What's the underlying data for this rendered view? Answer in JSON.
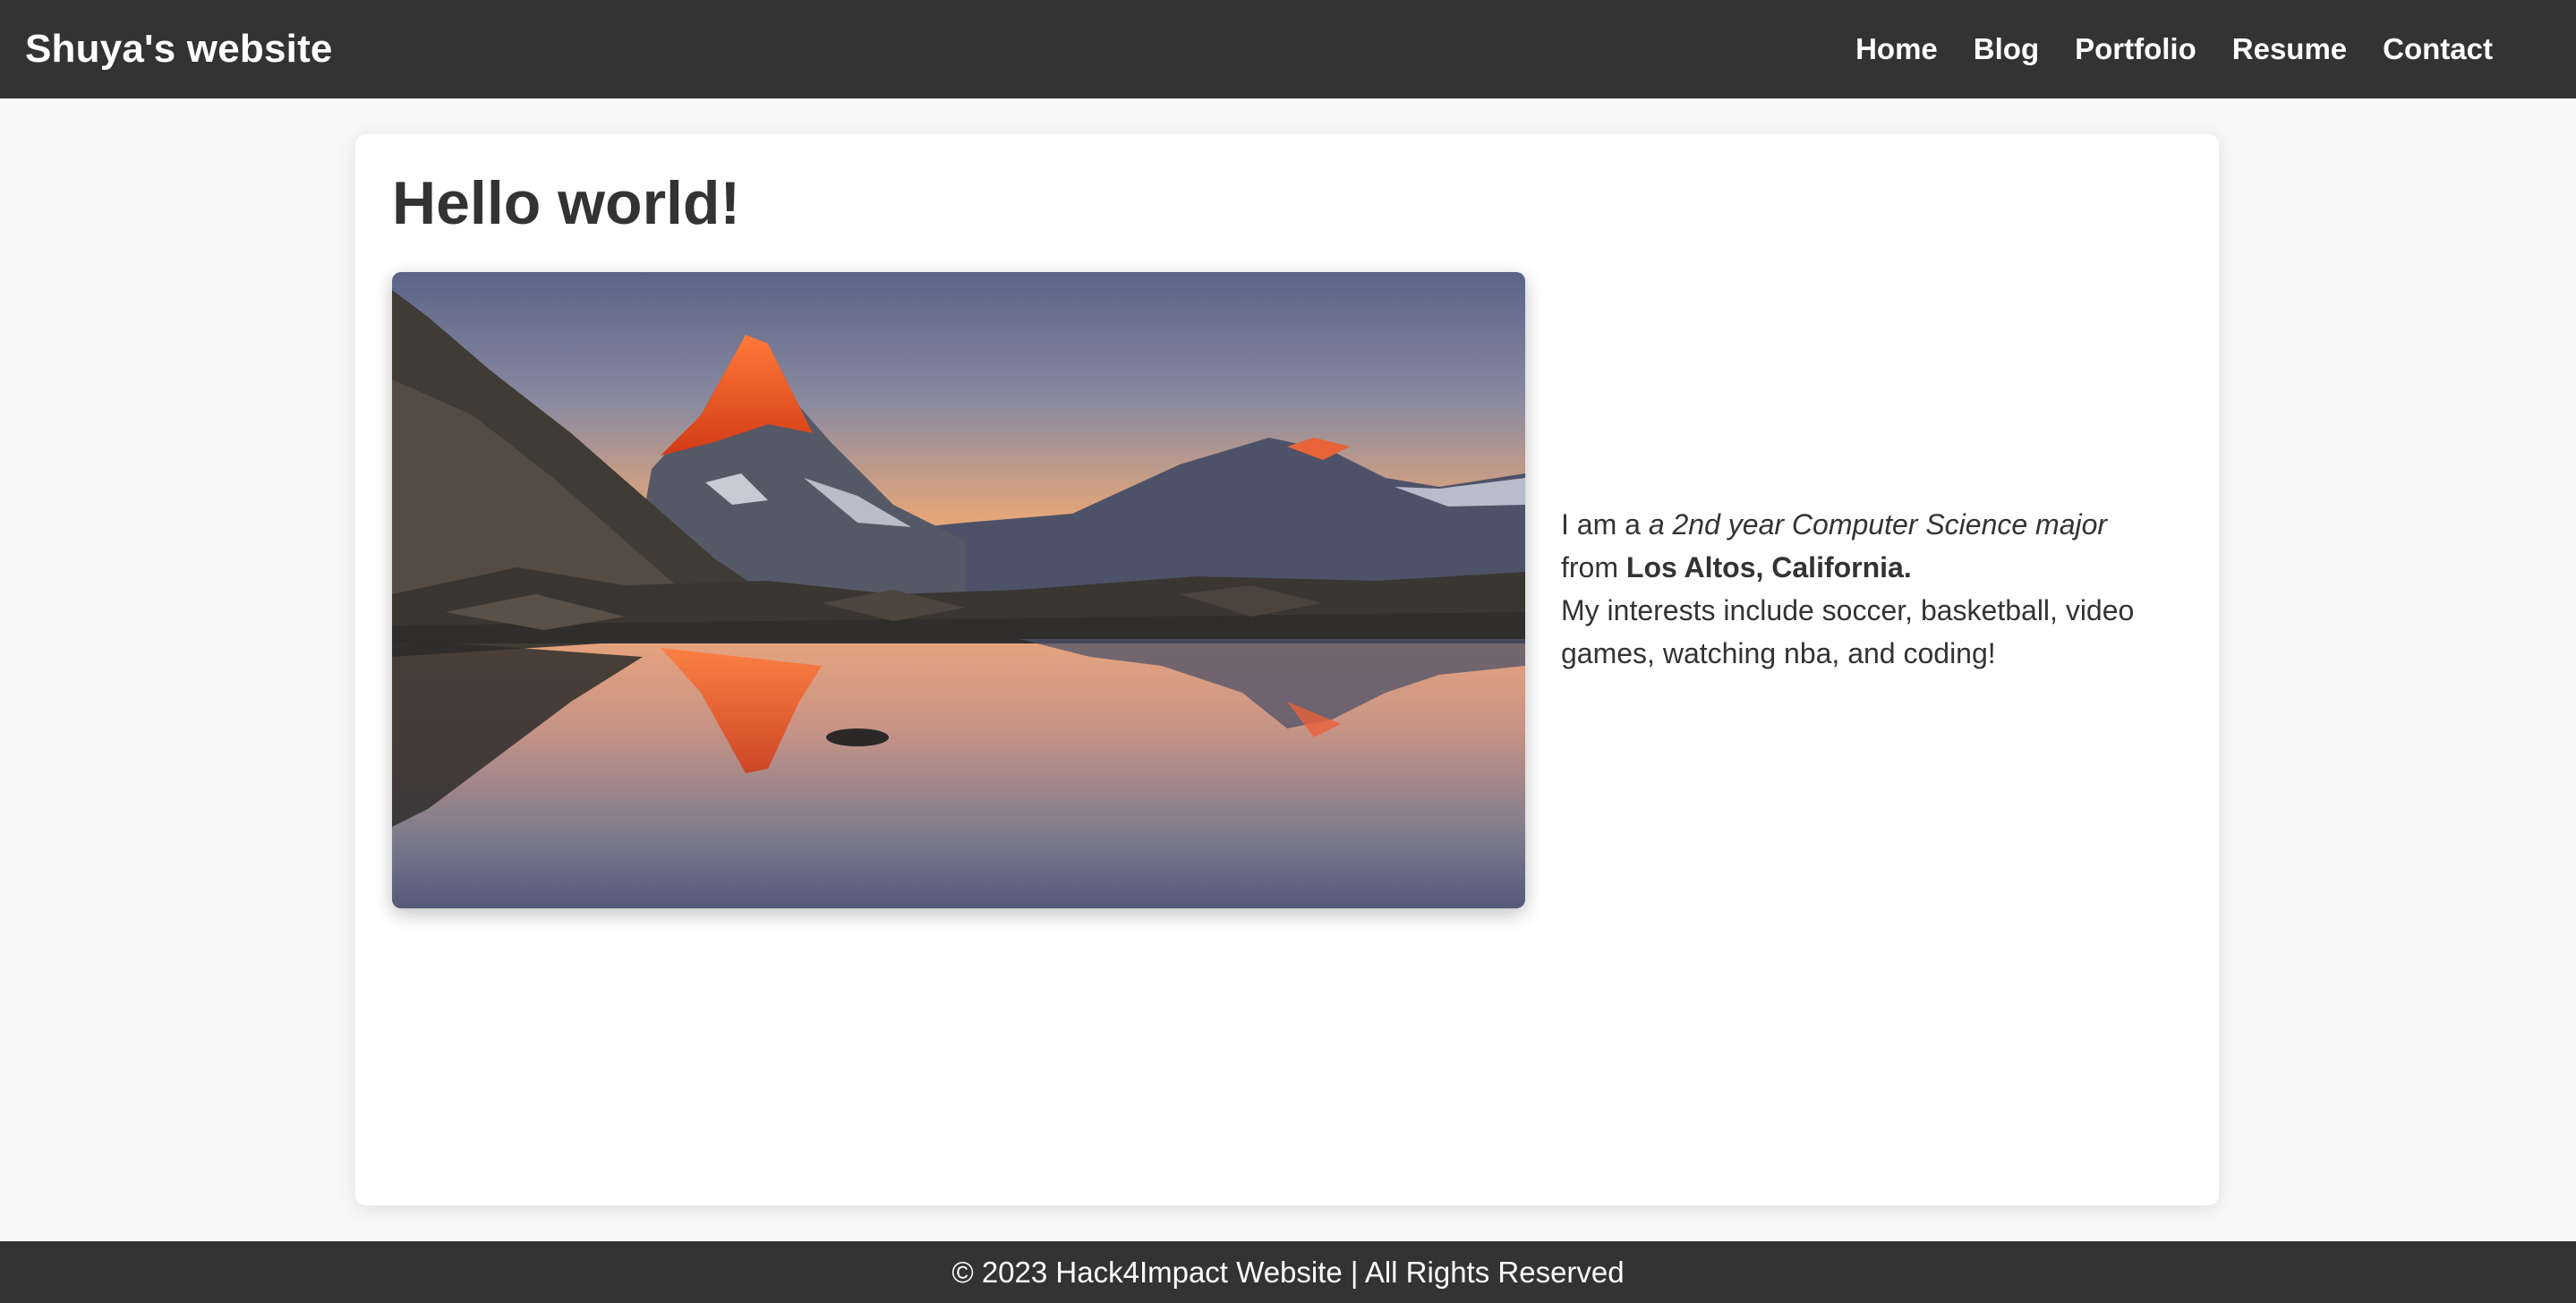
{
  "header": {
    "site_title": "Shuya's website",
    "nav": [
      {
        "label": "Home"
      },
      {
        "label": "Blog"
      },
      {
        "label": "Portfolio"
      },
      {
        "label": "Resume"
      },
      {
        "label": "Contact"
      }
    ]
  },
  "main": {
    "heading": "Hello world!",
    "image": {
      "subject": "mountain-lake-reflection"
    },
    "bio": {
      "line1_prefix": "I am a ",
      "major": "a 2nd year Computer Science major",
      "from_prefix": "from ",
      "location": "Los Altos, California.",
      "interests": "My interests include soccer, basketball, video games, watching nba, and coding!"
    }
  },
  "footer": {
    "text": "© 2023 Hack4Impact Website | All Rights Reserved"
  },
  "colors": {
    "navbar_bg": "#333333",
    "page_bg": "#f8f8f8",
    "card_bg": "#ffffff",
    "text": "#333333"
  }
}
